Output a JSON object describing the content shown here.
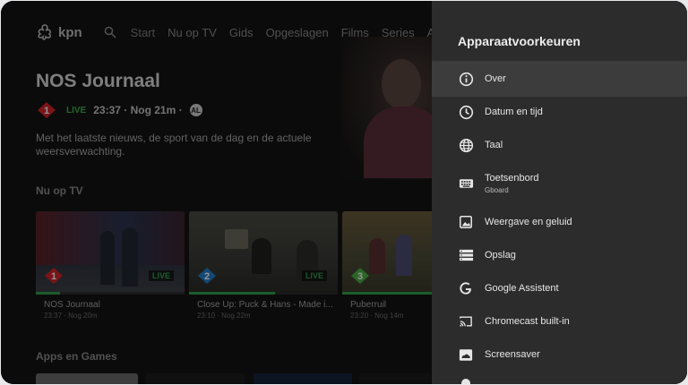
{
  "app": {
    "brand": "kpn",
    "nav": [
      "Start",
      "Nu op TV",
      "Gids",
      "Opgeslagen",
      "Films",
      "Series",
      "A"
    ],
    "hero": {
      "title": "NOS Journaal",
      "live": "LIVE",
      "time": "23:37 · Nog 21m ·",
      "age_rating": "AL",
      "description": "Met het laatste nieuws, de sport van de dag en de actuele weersverwachting."
    },
    "section_now": "Nu op TV",
    "cards": [
      {
        "title": "NOS Journaal",
        "time": "23:37 · Nog 20m",
        "live": "LIVE",
        "channel": "1",
        "progress": 0.16
      },
      {
        "title": "Close Up: Puck & Hans - Made i...",
        "time": "23:10 · Nog 22m",
        "live": "LIVE",
        "channel": "2",
        "progress": 0.58
      },
      {
        "title": "Puberruil",
        "time": "23:20 · Nog 14m",
        "live": "",
        "channel": "3",
        "progress": 0.62
      }
    ],
    "section_apps": "Apps en Games"
  },
  "colors": {
    "accent_green": "#2fa14a",
    "npo_red": "#d2232a",
    "npo_blue": "#1f7fc9",
    "npo_green": "#4cae45",
    "panel_bg": "#2c2c2c"
  },
  "panel": {
    "title": "Apparaatvoorkeuren",
    "items": [
      {
        "label": "Over",
        "icon": "info-icon",
        "selected": true
      },
      {
        "label": "Datum en tijd",
        "icon": "clock-icon"
      },
      {
        "label": "Taal",
        "icon": "globe-icon"
      },
      {
        "label": "Toetsenbord",
        "sublabel": "Gboard",
        "icon": "keyboard-icon"
      },
      {
        "label": "Weergave en geluid",
        "icon": "image-icon"
      },
      {
        "label": "Opslag",
        "icon": "storage-icon"
      },
      {
        "label": "Google Assistent",
        "icon": "google-icon"
      },
      {
        "label": "Chromecast built-in",
        "icon": "cast-icon"
      },
      {
        "label": "Screensaver",
        "icon": "screensaver-icon"
      }
    ]
  }
}
